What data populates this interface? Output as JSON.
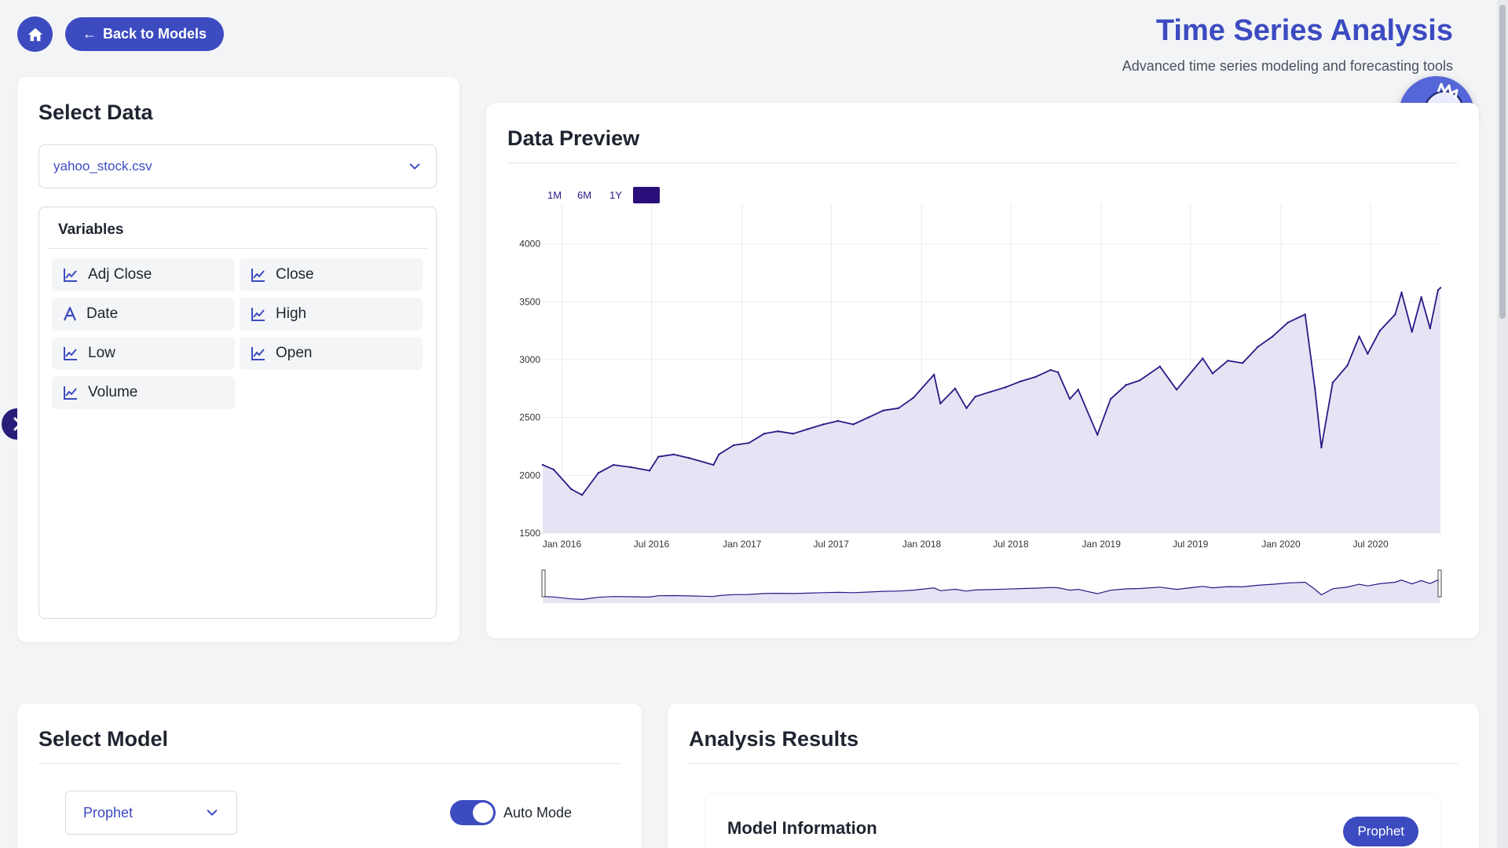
{
  "header": {
    "title": "Time Series Analysis",
    "subtitle": "Advanced time series modeling and forecasting tools",
    "back_label": "Back to Models"
  },
  "select_data": {
    "title": "Select Data",
    "file": "yahoo_stock.csv",
    "variables_title": "Variables",
    "variables": [
      {
        "label": "Adj Close",
        "icon": "line-chart-icon"
      },
      {
        "label": "Close",
        "icon": "line-chart-icon"
      },
      {
        "label": "Date",
        "icon": "text-type-icon"
      },
      {
        "label": "High",
        "icon": "line-chart-icon"
      },
      {
        "label": "Low",
        "icon": "line-chart-icon"
      },
      {
        "label": "Open",
        "icon": "line-chart-icon"
      },
      {
        "label": "Volume",
        "icon": "line-chart-icon"
      }
    ]
  },
  "data_preview": {
    "title": "Data Preview",
    "range_buttons": [
      "1M",
      "6M",
      "1Y",
      ""
    ]
  },
  "select_model": {
    "title": "Select Model",
    "model": "Prophet",
    "auto_mode_label": "Auto Mode",
    "auto_mode": true
  },
  "analysis_results": {
    "title": "Analysis Results",
    "model_info_title": "Model Information",
    "model_badge": "Prophet"
  },
  "colors": {
    "accent": "#3c4bc0",
    "line": "#2a1a86",
    "area": "#e7e3f4"
  },
  "chart_data": {
    "type": "area",
    "x_ticks": [
      "Jan 2016",
      "Jul 2016",
      "Jan 2017",
      "Jul 2017",
      "Jan 2018",
      "Jul 2018",
      "Jan 2019",
      "Jul 2019",
      "Jan 2020",
      "Jul 2020"
    ],
    "y_ticks": [
      1500,
      2000,
      2500,
      3000,
      3500,
      4000
    ],
    "ylim": [
      1500,
      4350
    ],
    "xlim": [
      "2015-11-23",
      "2020-11-20"
    ],
    "grid": true,
    "series": [
      {
        "x": [
          "2015-11-23",
          "2015-12-15",
          "2016-01-20",
          "2016-02-11",
          "2016-03-15",
          "2016-04-15",
          "2016-05-20",
          "2016-06-27",
          "2016-07-15",
          "2016-08-15",
          "2016-09-15",
          "2016-11-04",
          "2016-11-15",
          "2016-12-15",
          "2017-01-15",
          "2017-02-15",
          "2017-03-15",
          "2017-04-15",
          "2017-05-15",
          "2017-06-15",
          "2017-07-15",
          "2017-08-15",
          "2017-09-15",
          "2017-10-15",
          "2017-11-15",
          "2017-12-15",
          "2018-01-26",
          "2018-02-08",
          "2018-03-10",
          "2018-04-02",
          "2018-04-20",
          "2018-05-20",
          "2018-06-20",
          "2018-07-20",
          "2018-08-20",
          "2018-09-20",
          "2018-10-05",
          "2018-10-29",
          "2018-11-15",
          "2018-12-24",
          "2019-01-20",
          "2019-02-20",
          "2019-03-20",
          "2019-04-30",
          "2019-06-03",
          "2019-07-26",
          "2019-08-15",
          "2019-09-15",
          "2019-10-15",
          "2019-11-15",
          "2019-12-15",
          "2020-01-15",
          "2020-02-19",
          "2020-03-10",
          "2020-03-23",
          "2020-04-15",
          "2020-05-15",
          "2020-06-08",
          "2020-06-25",
          "2020-07-20",
          "2020-08-20",
          "2020-09-02",
          "2020-09-23",
          "2020-10-12",
          "2020-10-30",
          "2020-11-15",
          "2020-11-20"
        ],
        "y": [
          2090,
          2050,
          1880,
          1830,
          2020,
          2090,
          2070,
          2040,
          2160,
          2180,
          2150,
          2090,
          2180,
          2260,
          2280,
          2360,
          2380,
          2360,
          2400,
          2440,
          2470,
          2440,
          2500,
          2560,
          2580,
          2670,
          2870,
          2620,
          2750,
          2580,
          2680,
          2720,
          2760,
          2810,
          2850,
          2910,
          2890,
          2660,
          2740,
          2350,
          2660,
          2780,
          2820,
          2940,
          2740,
          3010,
          2880,
          2990,
          2970,
          3110,
          3200,
          3320,
          3390,
          2750,
          2240,
          2800,
          2950,
          3200,
          3050,
          3250,
          3390,
          3580,
          3240,
          3540,
          3270,
          3600,
          3620
        ]
      }
    ]
  }
}
